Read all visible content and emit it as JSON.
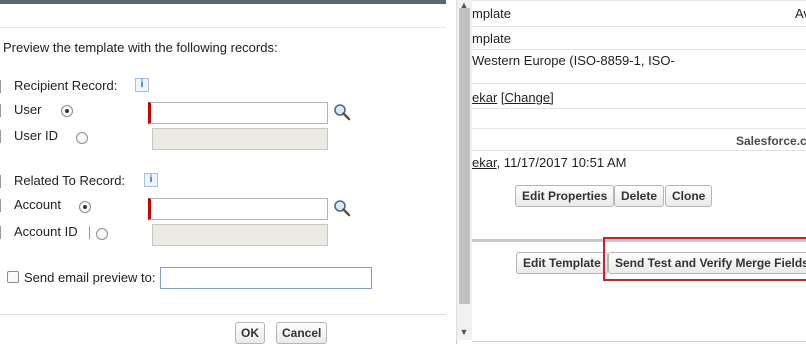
{
  "background": {
    "row1_text": "mplate",
    "row1_right": "Av",
    "row2_text": "mplate",
    "row3_text": "Western Europe (ISO-8859-1, ISO-",
    "row4_name": "ekar",
    "row4_change": "[Change]",
    "salesforce_label": "Salesforce.c",
    "row5_name": "ekar",
    "row5_date": ", 11/17/2017 10:51 AM",
    "buttons": {
      "edit_properties": "Edit Properties",
      "delete": "Delete",
      "clone": "Clone",
      "edit_template": "Edit Template",
      "send_test": "Send Test and Verify Merge Fields"
    },
    "highlight_color": "#d41f26"
  },
  "dialog": {
    "intro": "Preview the template with the following records:",
    "recipient_label": "Recipient Record:",
    "user_label": "User",
    "user_id_label": "User ID",
    "related_label": "Related To Record:",
    "account_label": "Account",
    "account_id_label": "Account ID",
    "send_preview_label": "Send email preview to:",
    "info_icon_glyph": "i",
    "ok_label": "OK",
    "cancel_label": "Cancel",
    "user_value": "",
    "user_id_value": "",
    "account_value": "",
    "account_id_value": "",
    "email_value": "",
    "recipient_selected": "User",
    "related_selected": "Account",
    "send_preview_checked": false,
    "accent_color": "#1f63b0",
    "required_color": "#cc0000"
  },
  "icons": {
    "info": "info-icon",
    "lookup": "magnifier-lookup-icon",
    "scroll_up": "chevron-up-icon",
    "scroll_down": "chevron-down-icon"
  }
}
